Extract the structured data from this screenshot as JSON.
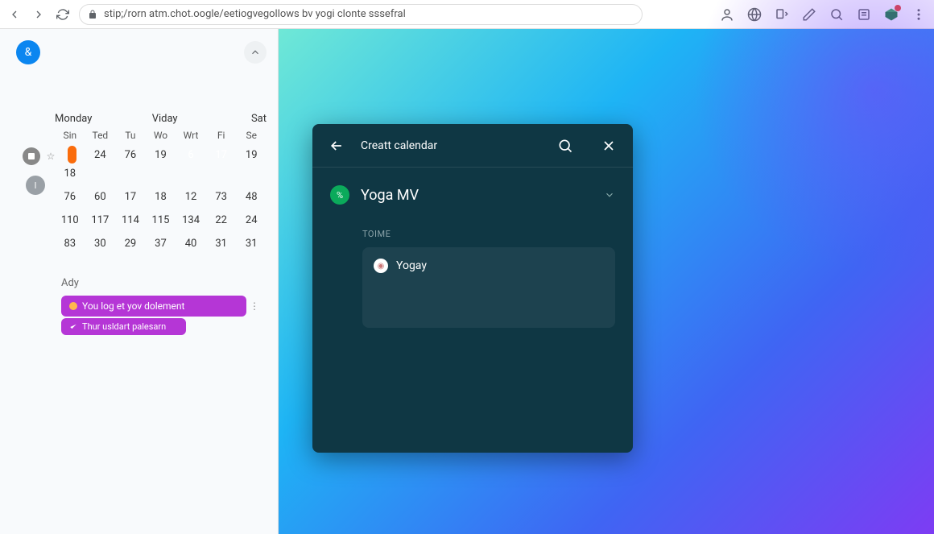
{
  "browser": {
    "url": "stip;/rorn atm.chot.oogle/eetiogvegollows bv yogi clonte sssefral"
  },
  "sidebar": {
    "avatar_glyph": "&",
    "month_row": {
      "mon": "Monday",
      "vid": "Viday",
      "sat": "Sat"
    },
    "day_labels": [
      "Sin",
      "Ted",
      "Tu",
      "Wo",
      "Wrt",
      "Fi",
      "Se"
    ],
    "side_circle_1": "I",
    "rows": [
      [
        "24",
        "76",
        "19",
        "6",
        "17",
        "19",
        "18"
      ],
      [
        "76",
        "60",
        "17",
        "18",
        "12",
        "73",
        "48"
      ],
      [
        "110",
        "117",
        "114",
        "115",
        "134",
        "22",
        "24"
      ],
      [
        "83",
        "30",
        "29",
        "37",
        "40",
        "31",
        "31"
      ]
    ],
    "ady_label": "Ady",
    "event1": "You log et yov dolement",
    "event2": "Thur usldart palesarn"
  },
  "modal": {
    "title": "Creatt calendar",
    "calendar_badge": "%",
    "calendar_name": "Yoga MV",
    "section_label": "TOIME",
    "user_name": "Yogay"
  }
}
